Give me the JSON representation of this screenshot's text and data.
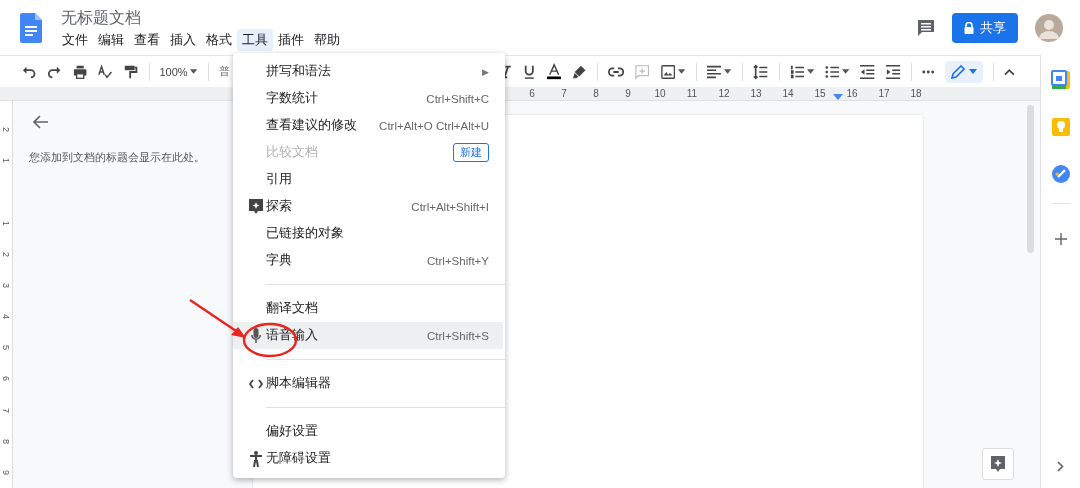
{
  "document": {
    "title": "无标题文档"
  },
  "menubar": [
    {
      "label": "文件",
      "selected": false
    },
    {
      "label": "编辑",
      "selected": false
    },
    {
      "label": "查看",
      "selected": false
    },
    {
      "label": "插入",
      "selected": false
    },
    {
      "label": "格式",
      "selected": false
    },
    {
      "label": "工具",
      "selected": true
    },
    {
      "label": "插件",
      "selected": false
    },
    {
      "label": "帮助",
      "selected": false
    }
  ],
  "share_button": {
    "label": "共享"
  },
  "toolbar": {
    "zoom": "100%",
    "style": "普"
  },
  "ruler": {
    "numbers": [
      "6",
      "7",
      "8",
      "9",
      "10",
      "11",
      "12",
      "13",
      "14",
      "15",
      "16",
      "17",
      "18"
    ]
  },
  "vertical_ruler": {
    "top_margin_numbers": [
      "2",
      "1"
    ],
    "numbers": [
      "1",
      "2",
      "3",
      "4",
      "5",
      "6",
      "7",
      "8",
      "9"
    ]
  },
  "outline": {
    "hint": "您添加到文档的标题会显示在此处。"
  },
  "tools_menu": [
    {
      "kind": "item",
      "label": "拼写和语法",
      "arrow": "▶",
      "disabled": false,
      "highlighted": false
    },
    {
      "kind": "item",
      "label": "字数统计",
      "shortcut": "Ctrl+Shift+C",
      "disabled": false,
      "highlighted": false
    },
    {
      "kind": "item",
      "label": "查看建议的修改",
      "shortcut": "Ctrl+Alt+O Ctrl+Alt+U",
      "disabled": false,
      "highlighted": false
    },
    {
      "kind": "item",
      "label": "比较文档",
      "badge": "新建",
      "disabled": true,
      "highlighted": false
    },
    {
      "kind": "item",
      "label": "引用",
      "disabled": false,
      "highlighted": false
    },
    {
      "kind": "item",
      "label": "探索",
      "shortcut": "Ctrl+Alt+Shift+I",
      "disabled": false,
      "highlighted": false
    },
    {
      "kind": "item",
      "label": "已链接的对象",
      "disabled": false,
      "highlighted": false
    },
    {
      "kind": "item",
      "label": "字典",
      "shortcut": "Ctrl+Shift+Y",
      "disabled": false,
      "highlighted": false
    },
    {
      "kind": "separator"
    },
    {
      "kind": "item",
      "label": "翻译文档",
      "disabled": false,
      "highlighted": false
    },
    {
      "kind": "item",
      "label": "语音输入",
      "shortcut": "Ctrl+Shift+S",
      "disabled": false,
      "highlighted": true
    },
    {
      "kind": "separator"
    },
    {
      "kind": "item",
      "label": "脚本编辑器",
      "disabled": false,
      "highlighted": false
    },
    {
      "kind": "separator"
    },
    {
      "kind": "item",
      "label": "偏好设置",
      "disabled": false,
      "highlighted": false
    },
    {
      "kind": "item",
      "label": "无障碍设置",
      "disabled": false,
      "highlighted": false
    }
  ]
}
